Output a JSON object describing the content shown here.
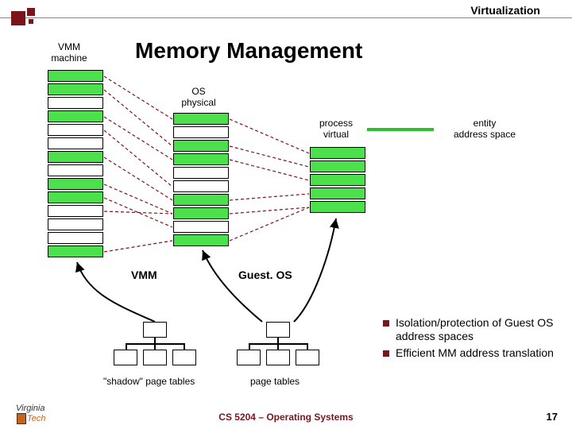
{
  "header": {
    "section": "Virtualization"
  },
  "title": "Memory Management",
  "captions": {
    "vmm_machine": "VMM\nmachine",
    "os_physical": "OS\nphysical",
    "process_virtual": "process\nvirtual",
    "entity_as": "entity\naddress space"
  },
  "row_labels": {
    "vmm": "VMM",
    "guest_os": "Guest. OS"
  },
  "columns": {
    "vmm_machine": [
      "g",
      "g",
      "w",
      "g",
      "w",
      "w",
      "g",
      "w",
      "g",
      "g",
      "w",
      "w",
      "w",
      "g"
    ],
    "os_physical": [
      "g",
      "w",
      "g",
      "g",
      "w",
      "w",
      "g",
      "g",
      "w",
      "g"
    ],
    "process_virtual": [
      "g",
      "g",
      "g",
      "g",
      "g"
    ]
  },
  "tree_labels": {
    "shadow": "\"shadow\" page tables",
    "pt": "page tables"
  },
  "bullets": [
    "Isolation/protection of Guest OS address spaces",
    "Efficient MM address translation"
  ],
  "footer": {
    "course": "CS 5204 – Operating Systems",
    "page": "17",
    "logo_v": "Virginia",
    "logo_t": "Tech"
  }
}
